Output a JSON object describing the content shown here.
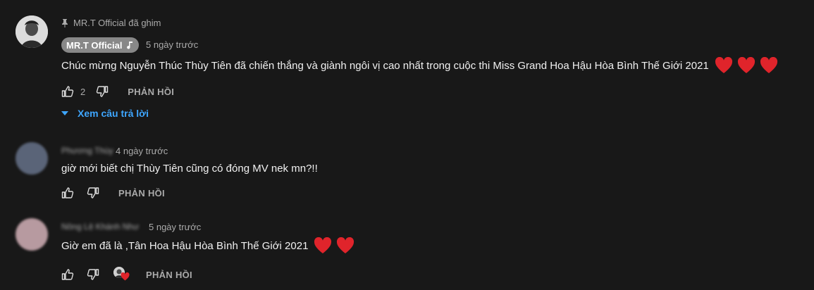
{
  "comments": [
    {
      "pinned_label": "MR.T Official đã ghim",
      "author": "MR.T Official",
      "time": "5 ngày trước",
      "text": "Chúc mừng Nguyễn Thúc Thùy Tiên đã chiến thắng và giành ngôi vị cao nhất trong cuộc thi Miss Grand Hoa Hậu Hòa Bình Thế Giới 2021",
      "hearts": 3,
      "likes": "2",
      "reply_label": "PHẢN HỒI",
      "view_replies_label": "Xem câu trả lời"
    },
    {
      "author": "Phương Thùy",
      "time": "4 ngày trước",
      "text": "giờ mới biết chị Thùy Tiên cũng có đóng MV nek mn?!!",
      "reply_label": "PHẢN HỒI"
    },
    {
      "author": "Nông Lệ Khánh Như",
      "time": "5 ngày trước",
      "text": "Giờ em đã là ,Tân Hoa Hậu Hòa Bình Thế Giới 2021",
      "hearts": 2,
      "reply_label": "PHẢN HỒI",
      "creator_heart": true
    }
  ],
  "colors": {
    "background": "#181818",
    "text": "#f1f1f1",
    "muted": "#aaaaaa",
    "link": "#3ea6ff",
    "owner_chip": "#888888",
    "heart": "#e0242b"
  },
  "icons": [
    "pin-icon",
    "music-note-icon",
    "thumb-up-icon",
    "thumb-down-icon",
    "caret-down-icon",
    "heart-icon"
  ]
}
